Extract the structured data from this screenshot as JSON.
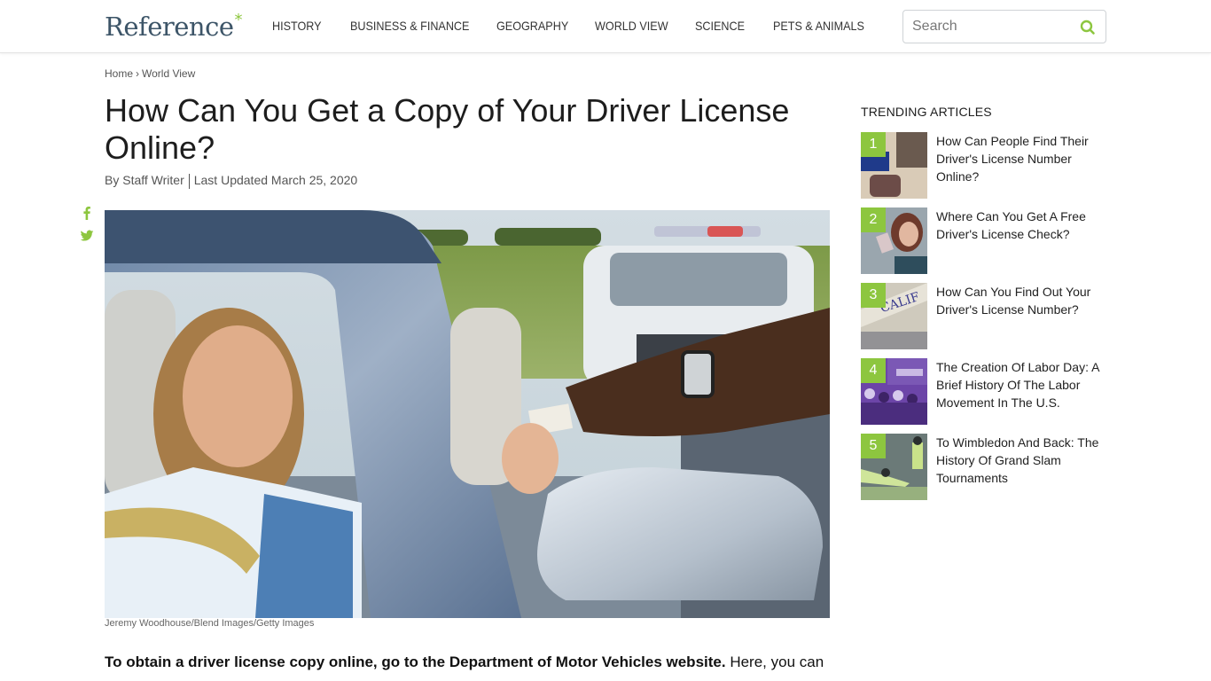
{
  "header": {
    "logo_text": "Reference",
    "logo_mark": "*",
    "nav": [
      {
        "label": "HISTORY"
      },
      {
        "label": "BUSINESS & FINANCE"
      },
      {
        "label": "GEOGRAPHY"
      },
      {
        "label": "WORLD VIEW"
      },
      {
        "label": "SCIENCE"
      },
      {
        "label": "PETS & ANIMALS"
      }
    ],
    "search": {
      "placeholder": "Search",
      "value": "",
      "icon": "search-icon"
    }
  },
  "breadcrumb": {
    "items": [
      {
        "label": "Home"
      },
      {
        "label": "World View"
      }
    ],
    "separator": "›"
  },
  "article": {
    "title": "How Can You Get a Copy of Your Driver License Online?",
    "author": "By Staff Writer",
    "updated": "Last Updated March 25, 2020",
    "image_alt": "Woman in convertible handing driver's license to police officer",
    "image_caption": "Jeremy Woodhouse/Blend Images/Getty Images",
    "lead_bold": "To obtain a driver license copy online, go to the Department of Motor Vehicles website.",
    "lead_rest": " Here, you can"
  },
  "social": [
    {
      "name": "facebook",
      "icon": "facebook-icon"
    },
    {
      "name": "twitter",
      "icon": "twitter-icon"
    }
  ],
  "sidebar": {
    "title": "TRENDING ARTICLES",
    "items": [
      {
        "num": "1",
        "title": "How Can People Find Their Driver's License Number Online?"
      },
      {
        "num": "2",
        "title": "Where Can You Get A Free Driver's License Check?"
      },
      {
        "num": "3",
        "title": "How Can You Find Out Your Driver's License Number?"
      },
      {
        "num": "4",
        "title": "The Creation Of Labor Day: A Brief History Of The Labor Movement In The U.S."
      },
      {
        "num": "5",
        "title": "To Wimbledon And Back: The History Of Grand Slam Tournaments"
      }
    ]
  },
  "colors": {
    "accent": "#8dc63f",
    "logo": "#3d5568",
    "text": "#1d1d1d"
  }
}
